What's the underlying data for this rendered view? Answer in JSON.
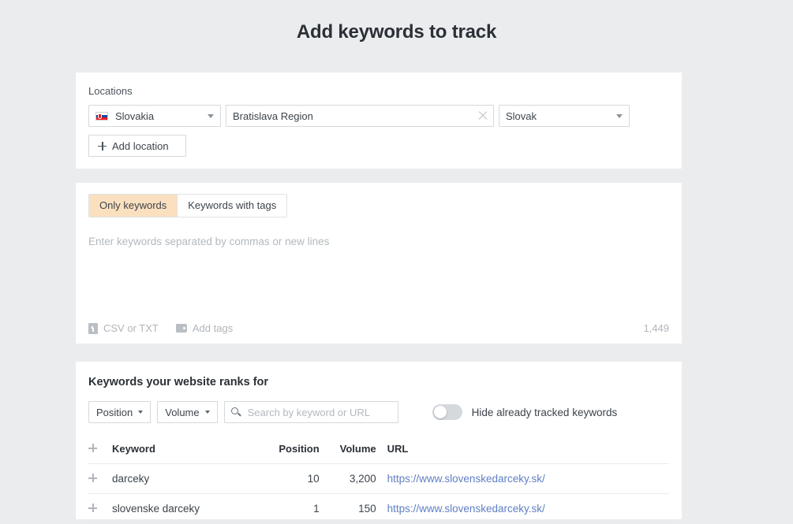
{
  "page": {
    "title": "Add keywords to track",
    "background_color": "#eaecee",
    "panel_color": "#ffffff",
    "accent_color": "#fbe0c0",
    "link_color": "#5f7fc4"
  },
  "locations": {
    "label": "Locations",
    "country": {
      "value": "Slovakia",
      "flag": "slovakia-flag-icon"
    },
    "region": {
      "value": "Bratislava Region",
      "clear_icon": "close-icon"
    },
    "language": {
      "value": "Slovak"
    },
    "add_button": {
      "label": "Add location",
      "icon": "plus-icon"
    }
  },
  "keywords_input": {
    "tabs": [
      {
        "label": "Only keywords",
        "active": true
      },
      {
        "label": "Keywords with tags",
        "active": false
      }
    ],
    "textarea_placeholder": "Enter keywords separated by commas or new lines",
    "footer": {
      "csv": {
        "label": "CSV or TXT",
        "icon": "upload-icon"
      },
      "tags": {
        "label": "Add tags",
        "icon": "tag-icon"
      },
      "count": "1,449"
    }
  },
  "ranked": {
    "heading": "Keywords your website ranks for",
    "filters": [
      {
        "label": "Position",
        "icon": "chevron-down-icon"
      },
      {
        "label": "Volume",
        "icon": "chevron-down-icon"
      }
    ],
    "search": {
      "placeholder": "Search by keyword or URL",
      "value": "",
      "icon": "search-icon"
    },
    "toggle": {
      "label": "Hide already tracked keywords",
      "on": false
    },
    "table": {
      "columns": [
        "Keyword",
        "Position",
        "Volume",
        "URL"
      ],
      "rows": [
        {
          "keyword": "darceky",
          "position": "10",
          "volume": "3,200",
          "url": "https://www.slovenskedarceky.sk/"
        },
        {
          "keyword": "slovenske darceky",
          "position": "1",
          "volume": "150",
          "url": "https://www.slovenskedarceky.sk/"
        }
      ]
    }
  }
}
